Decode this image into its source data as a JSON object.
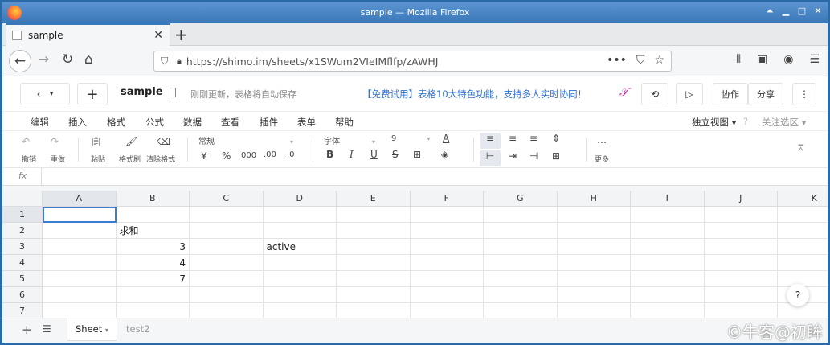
{
  "window": {
    "title": "sample — Mozilla Firefox"
  },
  "browser": {
    "tab_title": "sample",
    "url_host": "https://shimo.im",
    "url_path": "/sheets/x1SWum2VIeIMflfp/zAWHJ"
  },
  "app": {
    "doc_title": "sample",
    "autosave": "刚刚更新，表格将自动保存",
    "promo": "【免费试用】表格10大特色功能，支持多人实时协同！",
    "collab_label": "协作",
    "share_label": "分享"
  },
  "menu": [
    "编辑",
    "插入",
    "格式",
    "公式",
    "数据",
    "查看",
    "插件",
    "表单",
    "帮助"
  ],
  "menu_right": {
    "view": "独立视图",
    "focus": "关注选区"
  },
  "toolbar": {
    "undo": "撤销",
    "redo": "重做",
    "paste": "粘贴",
    "format_painter": "格式刷",
    "clear_format": "清除格式",
    "number_format": "常规",
    "currency": "¥",
    "percent": "%",
    "thousands": "000",
    "dec_inc": ".00",
    "dec_dec": ".0",
    "font": "字体",
    "font_size": "9",
    "more": "更多"
  },
  "formula_bar": {
    "fx": "fx"
  },
  "sheet": {
    "columns": [
      "A",
      "B",
      "C",
      "D",
      "E",
      "F",
      "G",
      "H",
      "I",
      "J",
      "K"
    ],
    "rows": [
      "1",
      "2",
      "3",
      "4",
      "5",
      "6",
      "7"
    ],
    "cells": {
      "B2": "求和",
      "B3": "3",
      "D3": "active",
      "B4": "4",
      "B5": "7"
    }
  },
  "sheets": {
    "active": "Sheet",
    "other": "test2"
  },
  "watermark": "©牛客@初眸",
  "help_label": "?"
}
